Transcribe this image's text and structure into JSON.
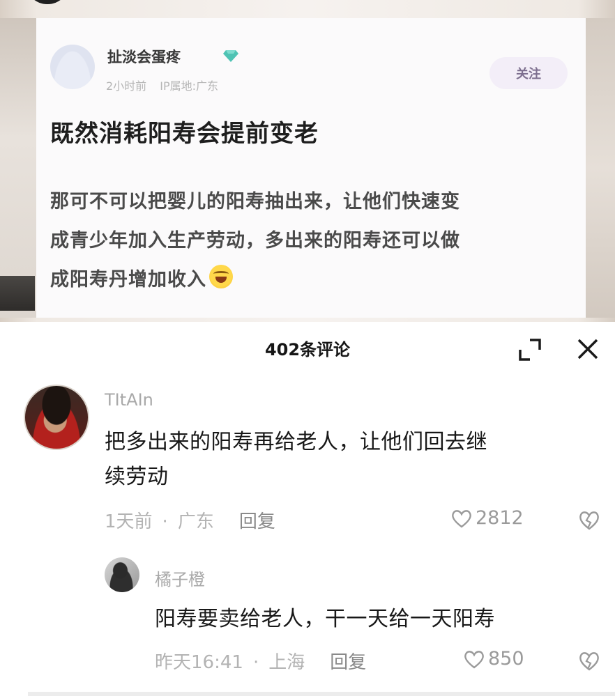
{
  "post": {
    "username": "扯淡会蛋疼",
    "time": "2小时前",
    "ip_location": "IP属地:广东",
    "follow_label": "关注",
    "title": "既然消耗阳寿会提前变老",
    "body_lines": [
      "那可不可以把婴儿的阳寿抽出来，让他们快速变",
      "成青少年加入生产劳动，多出来的阳寿还可以做",
      "成阳寿丹增加收入"
    ]
  },
  "comments_header": {
    "count_label": "402条评论"
  },
  "comments": [
    {
      "username": "TItAIn",
      "text_lines": [
        "把多出来的阳寿再给老人，让他们回去继",
        "续劳动"
      ],
      "time": "1天前",
      "separator": "·",
      "location": "广东",
      "reply_label": "回复",
      "likes": "2812"
    },
    {
      "username": "橘子橙",
      "text_lines": [
        "阳寿要卖给老人，干一天给一天阳寿"
      ],
      "time": "昨天16:41",
      "separator": "·",
      "location": "上海",
      "reply_label": "回复",
      "likes": "850"
    }
  ],
  "colors": {
    "diamond": "#4fc3b4",
    "follow_bg": "#f3eef8",
    "follow_text": "#7d6f8f",
    "meta_text": "#b3b3b3"
  },
  "icons": [
    "diamond-icon",
    "laugh-emoji",
    "expand-icon",
    "close-icon",
    "heart-icon",
    "dislike-icon"
  ]
}
